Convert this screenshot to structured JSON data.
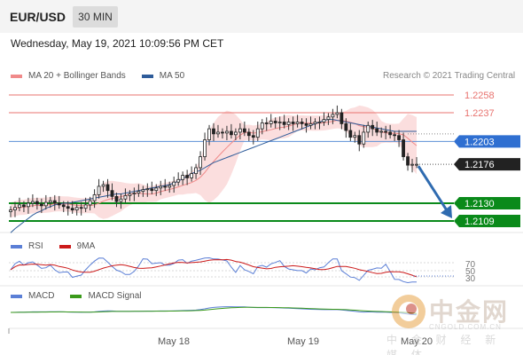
{
  "header": {
    "symbol": "EUR/USD",
    "interval": "30 MIN",
    "datetime": "Wednesday, May 19, 2021 10:09:56 PM CET"
  },
  "legend": {
    "ma20": "MA 20 + Bollinger Bands",
    "ma50": "MA 50",
    "copyright": "Research © 2021 Trading Central",
    "rsi": "RSI",
    "rsi_ma": "9MA",
    "macd": "MACD",
    "macd_signal": "MACD Signal"
  },
  "levels": {
    "resistance_2": "1.2258",
    "resistance_1": "1.2237",
    "pivot": "1.2203",
    "last": "1.2176",
    "support_1": "1.2130",
    "support_2": "1.2109"
  },
  "rsi_levels": [
    "70",
    "50",
    "30"
  ],
  "x_labels": [
    "May 18",
    "May 19",
    "May 20"
  ],
  "watermark": {
    "name": "中金网",
    "url": "CNGOLD.COM.CN",
    "tagline": "中 金 财 经 新 媒 体"
  },
  "colors": {
    "ma20": "#f08a8a",
    "ma50": "#2e5c9a",
    "band_fill": "#fbdede",
    "resistance": "#e8736f",
    "pivot": "#5b8fd6",
    "support": "#0a8a1a",
    "last_price": "#222222",
    "arrow": "#2f6bb0",
    "rsi": "#5b7fd6",
    "rsi_ma": "#cc1a1a",
    "macd": "#5b7fd6",
    "macd_signal": "#3a9a1a"
  },
  "chart_data": {
    "type": "line",
    "subtype": "candlestick",
    "symbol": "EUR/USD",
    "timeframe": "30 MIN",
    "y_range": [
      1.2095,
      1.2265
    ],
    "horizontal_levels": [
      1.2258,
      1.2237,
      1.2203,
      1.2176,
      1.213,
      1.2109
    ],
    "close": [
      1.2122,
      1.2125,
      1.2128,
      1.2126,
      1.213,
      1.2132,
      1.2129,
      1.2127,
      1.2131,
      1.2133,
      1.213,
      1.2128,
      1.2126,
      1.2124,
      1.2122,
      1.2125,
      1.2124,
      1.2128,
      1.2133,
      1.214,
      1.215,
      1.2152,
      1.2145,
      1.2138,
      1.2132,
      1.2135,
      1.2139,
      1.2141,
      1.2142,
      1.2144,
      1.2146,
      1.2147,
      1.2145,
      1.2148,
      1.215,
      1.2149,
      1.2151,
      1.2155,
      1.2158,
      1.2163,
      1.216,
      1.2165,
      1.2172,
      1.2185,
      1.2205,
      1.2218,
      1.2212,
      1.2214,
      1.2213,
      1.2215,
      1.2211,
      1.2214,
      1.2218,
      1.2214,
      1.221,
      1.2208,
      1.2218,
      1.2225,
      1.2224,
      1.2227,
      1.2225,
      1.2226,
      1.2223,
      1.2226,
      1.2224,
      1.2226,
      1.2224,
      1.2222,
      1.2224,
      1.2226,
      1.2226,
      1.2229,
      1.2232,
      1.2235,
      1.2237,
      1.2224,
      1.2216,
      1.2208,
      1.221,
      1.22,
      1.2214,
      1.2222,
      1.2218,
      1.2214,
      1.2215,
      1.2214,
      1.2211,
      1.221,
      1.2205,
      1.2185,
      1.2175,
      1.2176,
      1.2176
    ],
    "ma50": [
      1.2095,
      1.21,
      1.2104,
      1.2108,
      1.2112,
      1.2116,
      1.2119,
      1.2121,
      1.2124,
      1.2126,
      1.2128,
      1.2129,
      1.213,
      1.213,
      1.2131,
      1.2132,
      1.2133,
      1.2134,
      1.2135,
      1.2136,
      1.2137,
      1.2138,
      1.2139,
      1.214,
      1.2141,
      1.2141,
      1.2142,
      1.2143,
      1.2144,
      1.2145,
      1.2146,
      1.2147,
      1.2148,
      1.2149,
      1.215,
      1.2151,
      1.2152,
      1.2154,
      1.2156,
      1.2159,
      1.2162,
      1.2165,
      1.2167,
      1.2169,
      1.2172,
      1.2175,
      1.2178,
      1.218,
      1.2182,
      1.2184,
      1.2186,
      1.2188,
      1.219,
      1.2192,
      1.2194,
      1.2196,
      1.2198,
      1.22,
      1.2202,
      1.2204,
      1.2206,
      1.2208,
      1.221,
      1.2212,
      1.2214,
      1.2216,
      1.2218,
      1.222,
      1.2222,
      1.2224,
      1.2226,
      1.2228,
      1.2229,
      1.2229,
      1.2228,
      1.2227,
      1.2226,
      1.2225,
      1.2224,
      1.2223,
      1.2222,
      1.2221,
      1.222,
      1.2219,
      1.2218,
      1.2217,
      1.2216,
      1.2215,
      1.2215,
      1.2215,
      1.2215,
      1.2215,
      1.2215
    ],
    "projection": {
      "from": 1.2176,
      "to": 1.2109,
      "direction": "down"
    }
  }
}
